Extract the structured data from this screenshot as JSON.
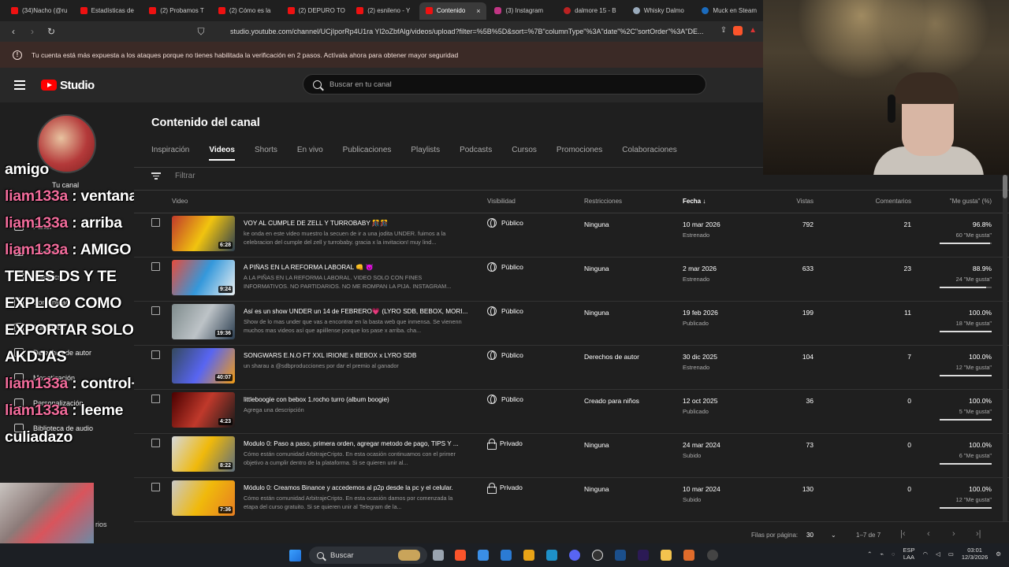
{
  "browser": {
    "tabs": [
      {
        "label": "(34)Nacho (@ru",
        "icon": "twitch-icon",
        "active": false
      },
      {
        "label": "Estadísticas de",
        "icon": "youtube-icon",
        "active": false
      },
      {
        "label": "(2) Probamos T",
        "icon": "youtube-icon",
        "active": false
      },
      {
        "label": "(2) Cómo es la",
        "icon": "youtube-icon",
        "active": false
      },
      {
        "label": "(2) DEPURO TO",
        "icon": "youtube-icon",
        "active": false
      },
      {
        "label": "(2) esnileno - Y",
        "icon": "youtube-icon",
        "active": false
      },
      {
        "label": "Contenido",
        "icon": "youtube-icon",
        "active": true
      },
      {
        "label": "(3) Instagram",
        "icon": "instagram-icon",
        "active": false
      },
      {
        "label": "dalmore 15 - B",
        "icon": "dalmore-icon",
        "active": false
      },
      {
        "label": "Whisky Dalmo",
        "icon": "whisky-icon",
        "active": false
      },
      {
        "label": "Muck en Steam",
        "icon": "steam-icon",
        "active": false
      }
    ],
    "url": "studio.youtube.com/channel/UCjIporRp4U1ra Yl2oZbfAlg/videos/upload?filter=%5B%5D&sort=%7B\"columnType\"%3A\"date\"%2C\"sortOrder\"%3A\"DE...",
    "tab_close": "×"
  },
  "warning": {
    "text": "Tu cuenta está más expuesta a los ataques porque no tienes habilitada la verificación en 2 pasos. Actívala ahora para obtener mayor seguridad"
  },
  "header": {
    "logo": "Studio",
    "search_placeholder": "Buscar en tu canal"
  },
  "sidebar": {
    "channel_label": "Tu canal",
    "items": [
      {
        "label": "Panel",
        "icon": "dashboard-icon"
      },
      {
        "label": "Contenido",
        "icon": "content-icon",
        "active": true
      },
      {
        "label": "Analytics",
        "icon": "analytics-icon"
      },
      {
        "label": "Comunidad",
        "icon": "community-icon"
      },
      {
        "label": "Subtítulos",
        "icon": "subtitles-icon"
      },
      {
        "label": "Derechos de autor",
        "icon": "copyright-icon"
      },
      {
        "label": "Monetización",
        "icon": "money-icon"
      },
      {
        "label": "Personalización",
        "icon": "customize-icon"
      },
      {
        "label": "Biblioteca de audio",
        "icon": "audio-icon"
      }
    ],
    "cam_label": "rios"
  },
  "chat": [
    {
      "user": "",
      "text": "amigo"
    },
    {
      "user": "liam133a",
      "text": " : ventana"
    },
    {
      "user": "liam133a",
      "text": " : arriba"
    },
    {
      "user": "liam133a",
      "text": " : AMIGO"
    },
    {
      "user": "",
      "text": "TENES DS Y TE"
    },
    {
      "user": "",
      "text": "EXPLICO COMO"
    },
    {
      "user": "",
      "text": "EXPORTAR SOLO ESO"
    },
    {
      "user": "",
      "text": "AKDJAS"
    },
    {
      "user": "liam133a",
      "text": " : control+M"
    },
    {
      "user": "liam133a",
      "text": " : leeme"
    },
    {
      "user": "",
      "text": "culiadazo"
    }
  ],
  "main": {
    "title": "Contenido del canal",
    "tabs": [
      "Inspiración",
      "Videos",
      "Shorts",
      "En vivo",
      "Publicaciones",
      "Playlists",
      "Podcasts",
      "Cursos",
      "Promociones",
      "Colaboraciones"
    ],
    "active_tab": "Videos",
    "filter_placeholder": "Filtrar",
    "columns": {
      "video": "Video",
      "visibility": "Visibilidad",
      "restrictions": "Restricciones",
      "date": "Fecha",
      "views": "Vistas",
      "comments": "Comentarios",
      "likes": "\"Me gusta\" (%)"
    },
    "rows": [
      {
        "title": "VOY AL CUMPLE DE ZELL Y TURROBABY 🎊🎊",
        "desc": "ke onda en este video muestro la secuen de ir a una jodita UNDER. fuimos a la celebracion del cumple del zell y turrobaby. gracia x la invitacion! muy lind...",
        "duration": "6:28",
        "visibility": "Público",
        "vis_icon": "globe-icon",
        "restriction": "Ninguna",
        "date": "10 mar 2026",
        "status": "Estrenado",
        "views": "792",
        "comments": "21",
        "likes_pct": "96.8%",
        "likes_count": "60 \"Me gusta\"",
        "likes_ratio": 0.968,
        "thumb": [
          "#c0392b",
          "#f1c40f",
          "#2c3e50"
        ]
      },
      {
        "title": "A PIÑAS EN LA REFORMA LABORAL 👊 😈",
        "desc": "A LA PIÑAS EN LA REFORMA LABORAL. VIDEO SOLO CON FINES INFORMATIVOS. NO PARTIDARIOS. NO ME ROMPAN LA PIJA. INSTAGRAM...",
        "duration": "9:24",
        "visibility": "Público",
        "vis_icon": "globe-icon",
        "restriction": "Ninguna",
        "date": "2 mar 2026",
        "status": "Estrenado",
        "views": "633",
        "comments": "23",
        "likes_pct": "88.9%",
        "likes_count": "24 \"Me gusta\"",
        "likes_ratio": 0.889,
        "thumb": [
          "#e74c3c",
          "#3498db",
          "#ecf0f1"
        ]
      },
      {
        "title": "Así es un show UNDER un 14 de FEBRERO💗 (LYRO SDB, BEBOX, MORI...",
        "desc": "Show de lo mas under que vas a encontrar en la basta web que inmensa. Se vienenn muchos mas videos así que apiillense porque los pase x arriba. cha...",
        "duration": "19:36",
        "visibility": "Público",
        "vis_icon": "globe-icon",
        "restriction": "Ninguna",
        "date": "19 feb 2026",
        "status": "Publicado",
        "views": "199",
        "comments": "11",
        "likes_pct": "100.0%",
        "likes_count": "18 \"Me gusta\"",
        "likes_ratio": 1.0,
        "thumb": [
          "#7f8c8d",
          "#bdc3c7",
          "#2c3e50"
        ]
      },
      {
        "title": "SONGWARS E.N.O FT XXL IRIONE x BEBOX x LYRO SDB",
        "desc": "un sharau a @sdbproducciones por dar el premio al ganador",
        "duration": "40:07",
        "visibility": "Público",
        "vis_icon": "globe-icon",
        "restriction": "Derechos de autor",
        "date": "30 dic 2025",
        "status": "Estrenado",
        "views": "104",
        "comments": "7",
        "likes_pct": "100.0%",
        "likes_count": "12 \"Me gusta\"",
        "likes_ratio": 1.0,
        "thumb": [
          "#34495e",
          "#5865f2",
          "#f39c12"
        ]
      },
      {
        "title": "littleboogie con bebox 1.rocho turro (album boogie)",
        "desc": "Agrega una descripción",
        "duration": "4:23",
        "visibility": "Público",
        "vis_icon": "globe-icon",
        "restriction": "Creado para niños",
        "date": "12 oct 2025",
        "status": "Publicado",
        "views": "36",
        "comments": "0",
        "likes_pct": "100.0%",
        "likes_count": "5 \"Me gusta\"",
        "likes_ratio": 1.0,
        "thumb": [
          "#4a0000",
          "#c0392b",
          "#1a1a1a"
        ]
      },
      {
        "title": "Modulo 0: Paso a paso, primera orden, agregar metodo de pago, TIPS Y ...",
        "desc": "Cómo están comunidad ArbitrajeCripto. En esta ocasión continuamos con el primer objetivo a cumplir dentro de la plataforma. Si se quieren unir al...",
        "duration": "8:22",
        "visibility": "Privado",
        "vis_icon": "lock-icon",
        "restriction": "Ninguna",
        "date": "24 mar 2024",
        "status": "Subido",
        "views": "73",
        "comments": "0",
        "likes_pct": "100.0%",
        "likes_count": "6 \"Me gusta\"",
        "likes_ratio": 1.0,
        "thumb": [
          "#d5d8dc",
          "#f0b90b",
          "#5d6d7e"
        ]
      },
      {
        "title": "Módulo 0: Creamos Binance y accedemos al p2p desde la pc y el celular.",
        "desc": "Cómo están comunidad ArbitrajeCripto. En esta ocasión damos por comenzada la etapa del curso gratuito. Si se quieren unir al Telegram de la...",
        "duration": "7:36",
        "visibility": "Privado",
        "vis_icon": "lock-icon",
        "restriction": "Ninguna",
        "date": "10 mar 2024",
        "status": "Subido",
        "views": "130",
        "comments": "0",
        "likes_pct": "100.0%",
        "likes_count": "12 \"Me gusta\"",
        "likes_ratio": 1.0,
        "thumb": [
          "#c9c9c9",
          "#f0b90b",
          "#e67e22"
        ]
      }
    ],
    "pager": {
      "rows_label": "Filas por página:",
      "rows_value": "30",
      "range": "1–7 de 7"
    }
  },
  "taskbar": {
    "search": "Buscar",
    "lang": "ESP",
    "lang2": "LAA",
    "time": "03:01",
    "date": "12/3/2026"
  },
  "colors": {
    "accent_red": "#ff0000",
    "chat_user": "#f06b9a",
    "warning_bg": "#3b2a26"
  }
}
